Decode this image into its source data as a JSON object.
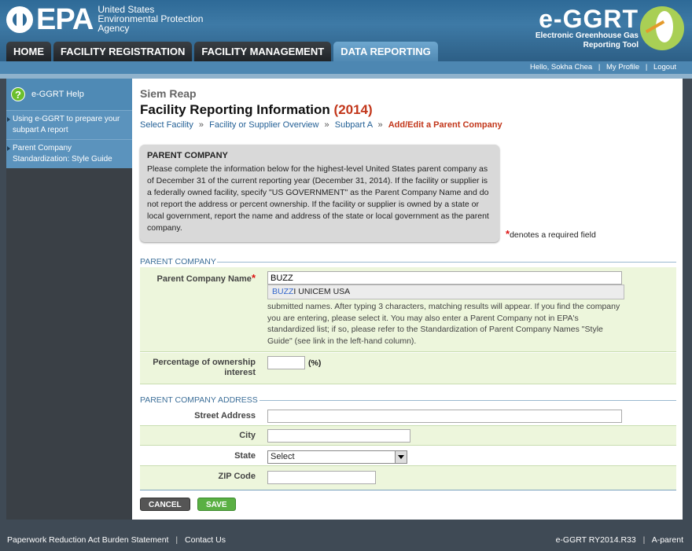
{
  "header": {
    "agency_line1": "United States",
    "agency_line2": "Environmental Protection",
    "agency_line3": "Agency",
    "epa": "EPA",
    "app_title": "e-GGRT",
    "app_sub1": "Electronic Greenhouse Gas",
    "app_sub2": "Reporting Tool"
  },
  "tabs": [
    "HOME",
    "FACILITY REGISTRATION",
    "FACILITY MANAGEMENT",
    "DATA REPORTING"
  ],
  "userbar": {
    "hello": "Hello, Sokha Chea",
    "profile": "My Profile",
    "logout": "Logout"
  },
  "sidebar": {
    "help": "e-GGRT Help",
    "links": [
      "Using e-GGRT to prepare your subpart A report",
      "Parent Company Standardization: Style Guide"
    ]
  },
  "main": {
    "site": "Siem Reap",
    "title": "Facility Reporting Information",
    "year": "(2014)",
    "breadcrumbs": [
      "Select Facility",
      "Facility or Supplier Overview",
      "Subpart A"
    ],
    "breadcrumb_current": "Add/Edit a Parent Company",
    "crumb_sep": "»",
    "info_heading": "PARENT COMPANY",
    "info_text": "Please complete the information below for the highest-level United States parent company as of December 31 of the current reporting year (December 31, 2014). If the facility or supplier is a federally owned facility, specify \"US GOVERNMENT\" as the Parent Company Name and do not report the address or percent ownership. If the facility or supplier is owned by a state or local government, report the name and address of the state or local government as the parent company.",
    "required_note": "denotes a required field",
    "required_star": "*",
    "section1": "PARENT COMPANY",
    "name_label": "Parent Company Name",
    "name_value": "BUZZ",
    "suggestion_match": "BUZZ",
    "suggestion_rest": "I UNICEM USA",
    "help_text": "submitted names. After typing 3 characters, matching results will appear. If you find the company you are entering, please select it. You may also enter a Parent Company not in EPA's standardized list; if so, please refer to the Standardization of Parent Company Names \"Style Guide\" (see link in the left-hand column).",
    "pct_label_1": "Percentage of ownership",
    "pct_label_2": "interest",
    "pct_value": "",
    "pct_unit": "(%)",
    "section2": "PARENT COMPANY ADDRESS",
    "street_label": "Street Address",
    "city_label": "City",
    "state_label": "State",
    "state_value": "Select",
    "zip_label": "ZIP Code",
    "cancel": "CANCEL",
    "save": "SAVE"
  },
  "footer": {
    "paperwork": "Paperwork Reduction Act Burden Statement",
    "contact": "Contact Us",
    "version": "e-GGRT RY2014.R33",
    "page_id": "A-parent"
  },
  "colors": {
    "accent": "#c2361a",
    "link": "#225f95",
    "row": "#edf6dc",
    "header": "#2e6a97"
  }
}
